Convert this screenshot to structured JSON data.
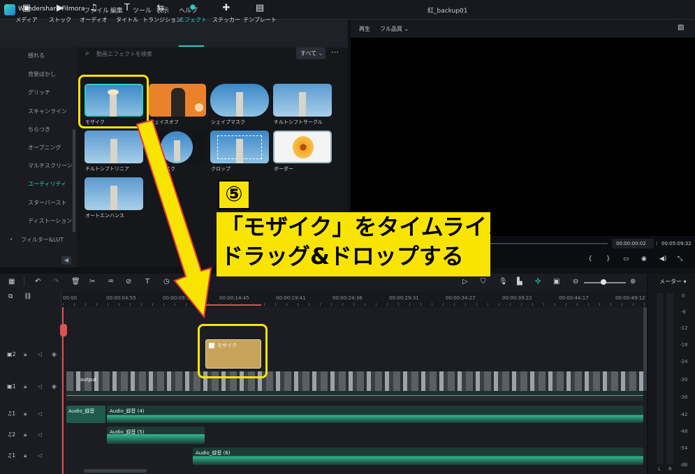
{
  "app": {
    "name": "Wondershare Filmora",
    "doc_title": "紅_backup01"
  },
  "menu": [
    "ファイル",
    "編集",
    "ツール",
    "表示",
    "ヘルプ"
  ],
  "toolbar": [
    {
      "label": "メディア",
      "icon": "media-icon"
    },
    {
      "label": "ストック",
      "icon": "stock-icon"
    },
    {
      "label": "オーディオ",
      "icon": "audio-icon"
    },
    {
      "label": "タイトル",
      "icon": "title-icon"
    },
    {
      "label": "トランジション",
      "icon": "transition-icon"
    },
    {
      "label": "エフェクト",
      "icon": "effect-icon",
      "active": true
    },
    {
      "label": "ステッカー",
      "icon": "sticker-icon"
    },
    {
      "label": "テンプレート",
      "icon": "template-icon"
    }
  ],
  "sidebar": {
    "items": [
      "揺れる",
      "背景ぼかし",
      "グリッチ",
      "スキャンライン",
      "ちらつき",
      "オープニング",
      "マルチスクリーン",
      "ユーティリティ",
      "スターバースト",
      "ディストーション"
    ],
    "active_index": 7,
    "footer": "フィルター&LUT"
  },
  "search": {
    "placeholder": "動画エフェクトを検索",
    "filter": "すべて"
  },
  "effects": [
    {
      "label": "モザイク"
    },
    {
      "label": "フェイスオフ"
    },
    {
      "label": "シェイプマスク"
    },
    {
      "label": "チルトシフトサークル"
    },
    {
      "label": "チルトシフトリニア"
    },
    {
      "label": "マスク"
    },
    {
      "label": "クロップ"
    },
    {
      "label": "ボーダー"
    },
    {
      "label": "オートエンハンス"
    }
  ],
  "preview": {
    "label": "再生",
    "quality": "フル品質",
    "current_time": "00:00:00:02",
    "separator": "/",
    "total_time": "00:05:09:32"
  },
  "timeline": {
    "ruler": [
      "00:00",
      "00:00:04:55",
      "00:00:09:50",
      "00:00:14:45",
      "00:00:19:41",
      "00:00:24:36",
      "00:00:29:31",
      "00:00:34:27",
      "00:00:39:22",
      "00:00:44:17",
      "00:00:49:12"
    ],
    "effect_clip": "モザイク",
    "video_clip": "output",
    "audio_clips": [
      "Audio_録音",
      "Audio_録音 (4)",
      "Audio_録音 (5)",
      "Audio_録音 (6)"
    ],
    "track_numbers": [
      "2",
      "1",
      "1",
      "2",
      "1"
    ]
  },
  "meter": {
    "label": "メーター",
    "scale": [
      "0",
      "-6",
      "-12",
      "-18",
      "-24",
      "-30",
      "-36",
      "-42",
      "-48",
      "-54",
      "dB"
    ],
    "channels": [
      "L",
      "R"
    ]
  },
  "annotation": {
    "step": "⑤",
    "line1": "「モザイク」をタイムラインに",
    "line2": "ドラッグ&ドロップする"
  },
  "colors": {
    "accent": "#25d0c7",
    "annotation_yellow": "#f8e400",
    "clip_gold": "#c8a45b",
    "audio_green": "#2fb98f"
  }
}
